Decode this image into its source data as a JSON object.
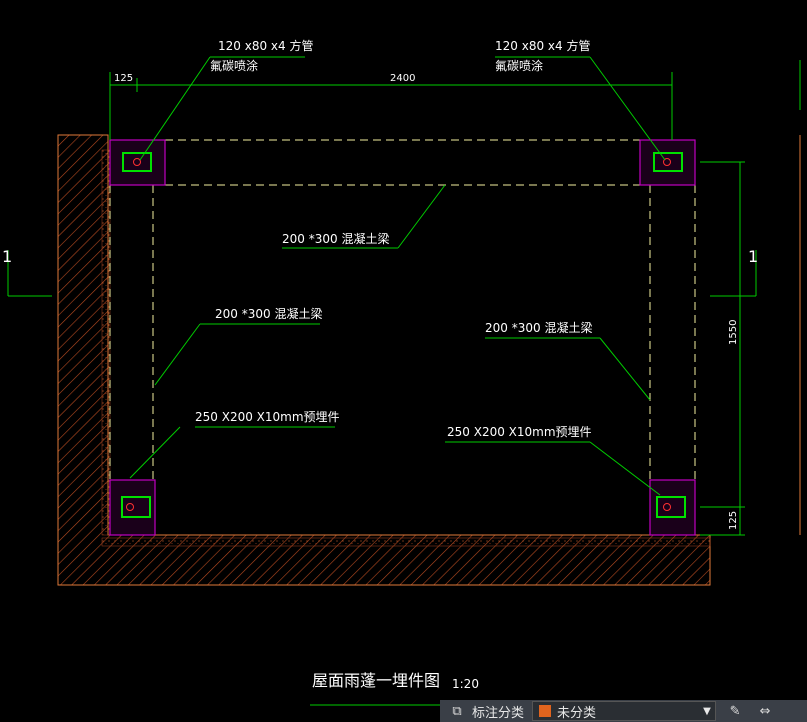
{
  "drawing": {
    "title": "屋面雨蓬一埋件图",
    "scale": "1:20",
    "section_left": "1",
    "section_right": "1",
    "dims": {
      "top_small": "125",
      "top_span": "2400",
      "right_span": "1550",
      "right_small": "125"
    },
    "labels": {
      "pipe_left_1": "120 x80 x4 方管",
      "pipe_left_2": "氟碳喷涂",
      "pipe_right_1": "120 x80 x4 方管",
      "pipe_right_2": "氟碳喷涂",
      "beam_top": "200 *300 混凝土梁",
      "beam_left": "200 *300 混凝土梁",
      "beam_right": "200 *300 混凝土梁",
      "embed_left": "250 X200 X10mm预埋件",
      "embed_right": "250 X200 X10mm预埋件"
    },
    "colors": {
      "wall": "#e07a3a",
      "beam": "#f5f0a0",
      "plate": "#c000c0",
      "pipe": "#00e000",
      "leader": "#00cc00",
      "dimension": "#00cc00"
    }
  },
  "statusbar": {
    "category_label": "标注分类",
    "category_value": "未分类",
    "category_color": "#e0641e"
  }
}
